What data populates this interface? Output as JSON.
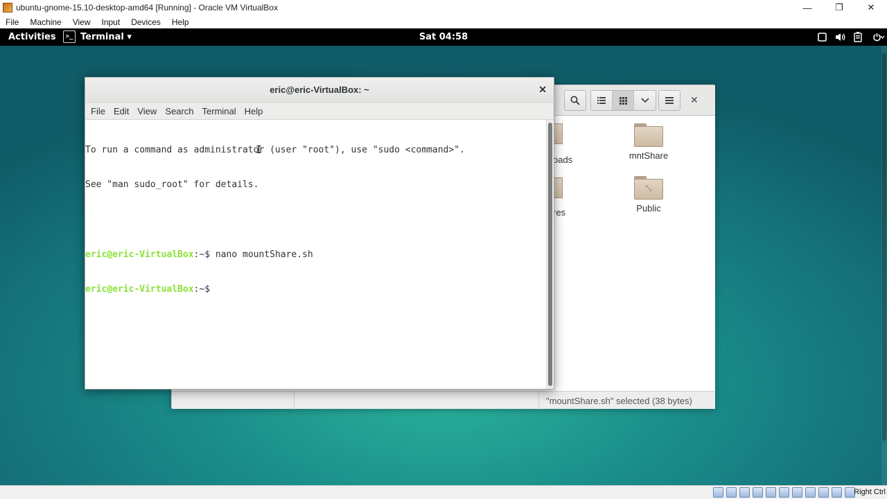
{
  "host": {
    "title": "ubuntu-gnome-15.10-desktop-amd64 [Running] - Oracle VM VirtualBox",
    "menu": [
      "File",
      "Machine",
      "View",
      "Input",
      "Devices",
      "Help"
    ],
    "window_buttons": {
      "minimize": "—",
      "restore": "❐",
      "close": "✕"
    },
    "host_key": "Right Ctrl"
  },
  "topbar": {
    "activities": "Activities",
    "app_name": "Terminal ▾",
    "app_icon_glyph": ">_",
    "clock": "Sat 04:58",
    "icons": [
      "window-icon",
      "volume-icon",
      "battery-icon",
      "power-icon"
    ]
  },
  "terminal": {
    "title": "eric@eric-VirtualBox: ~",
    "close": "✕",
    "menu": [
      "File",
      "Edit",
      "View",
      "Search",
      "Terminal",
      "Help"
    ],
    "lines": [
      {
        "type": "text",
        "text": "To run a command as administrator (user \"root\"), use \"sudo <command>\"."
      },
      {
        "type": "text",
        "text": "See \"man sudo_root\" for details."
      },
      {
        "type": "text",
        "text": ""
      },
      {
        "type": "prompt",
        "user": "eric@eric-VirtualBox",
        "path": ":~",
        "symbol": "$ ",
        "cmd": "nano mountShare.sh"
      },
      {
        "type": "prompt",
        "user": "eric@eric-VirtualBox",
        "path": ":~",
        "symbol": "$ ",
        "cmd": ""
      }
    ],
    "cursor_glyph": "I"
  },
  "files": {
    "close": "✕",
    "folders": [
      {
        "name": "mntShare",
        "emblem": ""
      },
      {
        "name": "Public",
        "emblem": "⤡"
      }
    ],
    "partial_labels": [
      "oads",
      "res"
    ],
    "status": "\"mountShare.sh\" selected (38 bytes)"
  }
}
